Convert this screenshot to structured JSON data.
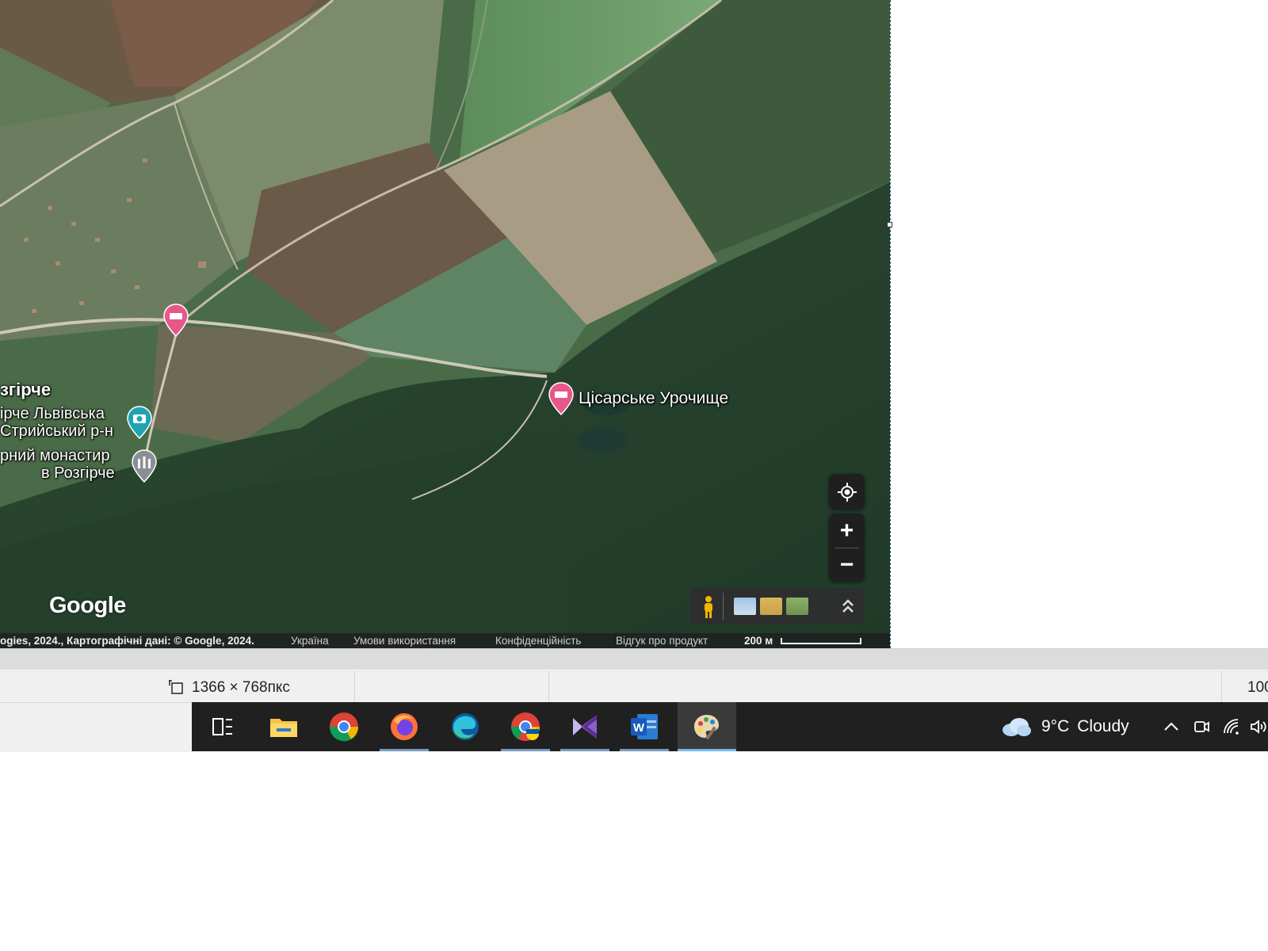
{
  "map": {
    "labels": {
      "rozhirche": "згірче",
      "cisarske": "Цісарське Урочище",
      "rozhirche_lviv_line1": "ірче Львівська",
      "rozhirche_lviv_line2": "Стрийський р-н",
      "monastery_line1": "рний монастир",
      "monastery_line2": "в Розгірче"
    },
    "google_logo": "Google",
    "attribution": {
      "data": "ogies, 2024., Картографічні дані: © Google, 2024.",
      "country": "Україна",
      "terms": "Умови використання",
      "privacy": "Конфіденційність",
      "feedback": "Відгук про продукт",
      "scale": "200 м"
    },
    "controls": {
      "zoom_in": "+",
      "zoom_out": "−"
    }
  },
  "statusbar": {
    "dimensions": "1366 × 768пкс",
    "zoom": "100"
  },
  "taskbar": {
    "apps": [
      {
        "name": "Task View",
        "icon": "task-view-icon"
      },
      {
        "name": "File Explorer",
        "icon": "folder-icon"
      },
      {
        "name": "Google Chrome",
        "icon": "chrome-icon"
      },
      {
        "name": "Firefox",
        "icon": "firefox-icon"
      },
      {
        "name": "Microsoft Edge",
        "icon": "edge-icon"
      },
      {
        "name": "Google Chrome (profile)",
        "icon": "chrome-profile-icon"
      },
      {
        "name": "Visual Studio",
        "icon": "visual-studio-icon"
      },
      {
        "name": "Microsoft Word",
        "icon": "word-icon"
      },
      {
        "name": "Paint",
        "icon": "paint-icon"
      }
    ],
    "weather": {
      "temp": "9°C",
      "condition": "Cloudy"
    }
  },
  "colors": {
    "taskbar_bg": "#202020",
    "pin_pink": "#e8578a",
    "pin_teal": "#1fa3b5",
    "pin_gray": "#8a8f96"
  }
}
